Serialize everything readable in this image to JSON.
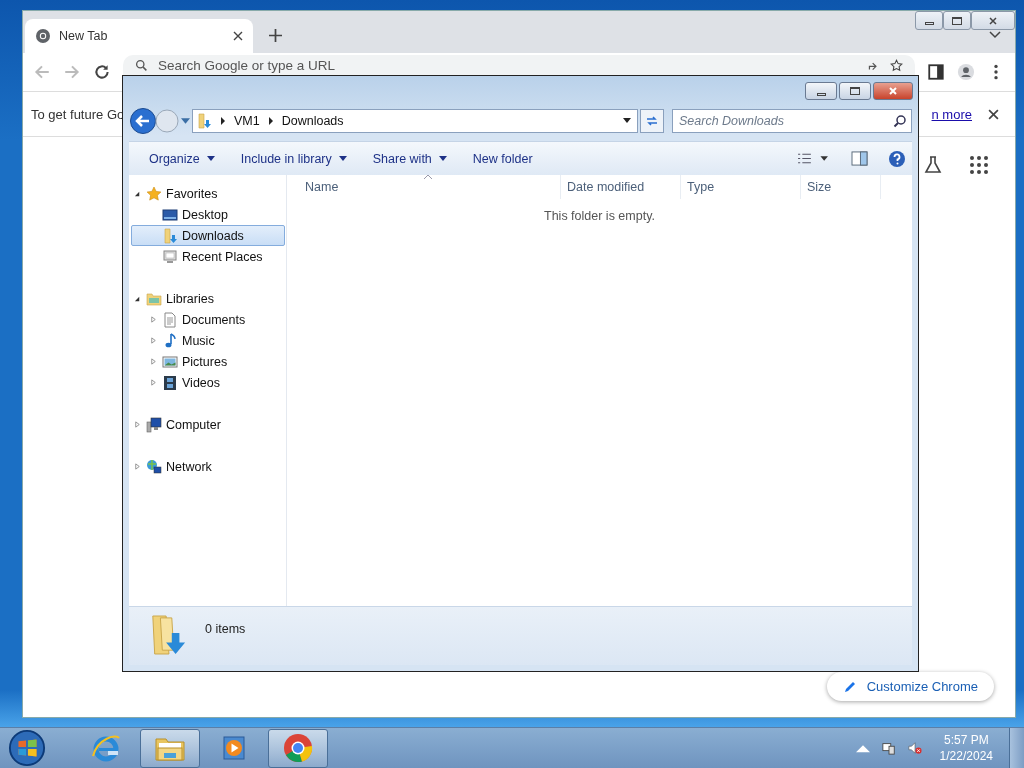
{
  "browser": {
    "tab": {
      "title": "New Tab",
      "selected": true
    },
    "omnibox": {
      "placeholder": "Search Google or type a URL"
    },
    "infobar": {
      "message": "To get future Go",
      "link": "n more"
    },
    "customize_button": "Customize Chrome"
  },
  "explorer": {
    "breadcrumb": [
      "VM1",
      "Downloads"
    ],
    "search": {
      "placeholder": "Search Downloads"
    },
    "toolbar": [
      {
        "label": "Organize",
        "dropdown": true
      },
      {
        "label": "Include in library",
        "dropdown": true
      },
      {
        "label": "Share with",
        "dropdown": true
      },
      {
        "label": "New folder",
        "dropdown": false
      }
    ],
    "columns": [
      {
        "label": "Name",
        "sorted": true
      },
      {
        "label": "Date modified",
        "sorted": false
      },
      {
        "label": "Type",
        "sorted": false
      },
      {
        "label": "Size",
        "sorted": false
      }
    ],
    "empty_message": "This folder is empty.",
    "tree": [
      {
        "label": "Favorites",
        "kind": "favorites",
        "expanded": true,
        "selected": false,
        "children": [
          {
            "label": "Desktop",
            "kind": "desktop",
            "selected": false
          },
          {
            "label": "Downloads",
            "kind": "downloads",
            "selected": true
          },
          {
            "label": "Recent Places",
            "kind": "recent",
            "selected": false
          }
        ]
      },
      {
        "label": "Libraries",
        "kind": "libraries",
        "expanded": true,
        "selected": false,
        "children": [
          {
            "label": "Documents",
            "kind": "documents",
            "expanded": false,
            "selected": false
          },
          {
            "label": "Music",
            "kind": "music",
            "expanded": false,
            "selected": false
          },
          {
            "label": "Pictures",
            "kind": "pictures",
            "expanded": false,
            "selected": false
          },
          {
            "label": "Videos",
            "kind": "videos",
            "expanded": false,
            "selected": false
          }
        ]
      },
      {
        "label": "Computer",
        "kind": "computer",
        "expanded": false,
        "selected": false
      },
      {
        "label": "Network",
        "kind": "network",
        "expanded": false,
        "selected": false
      }
    ],
    "status": "0 items"
  },
  "taskbar": {
    "apps": [
      {
        "kind": "browser-e",
        "open": false
      },
      {
        "kind": "folders",
        "open": true
      },
      {
        "kind": "media",
        "open": false
      },
      {
        "kind": "chrome",
        "open": true
      }
    ],
    "time": "5:57 PM",
    "date": "1/22/2024"
  }
}
